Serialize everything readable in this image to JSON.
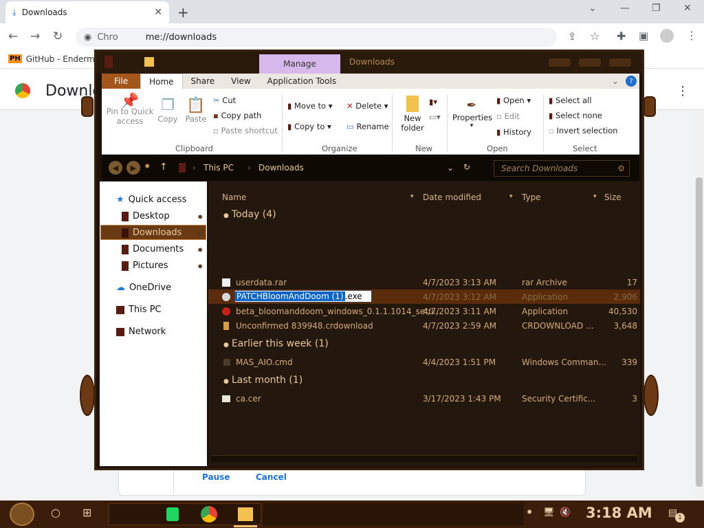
{
  "browser": {
    "tab_title": "Downloads",
    "tab_close": "✕",
    "new_tab": "+",
    "url_prefix": "Chro",
    "url": "me://downloads",
    "bookmark_badge": "PH",
    "bookmark_label": "GitHub - Enderma",
    "page_title": "Downlo",
    "pause": "Pause",
    "cancel": "Cancel"
  },
  "explorer": {
    "manage_tab": "Manage",
    "window_title": "Downloads",
    "tabs": [
      "File",
      "Home",
      "Share",
      "View",
      "Application Tools"
    ],
    "ribbon": {
      "pin": "Pin to Quick access",
      "copy": "Copy",
      "paste": "Paste",
      "cut": "Cut",
      "copy_path": "Copy path",
      "paste_shortcut": "Paste shortcut",
      "move_to": "Move to ▾",
      "copy_to": "Copy to ▾",
      "delete": "Delete ▾",
      "rename": "Rename",
      "new_folder": "New folder",
      "properties": "Properties",
      "open": "Open ▾",
      "edit": "Edit",
      "history": "History",
      "select_all": "Select all",
      "select_none": "Select none",
      "invert_selection": "Invert selection",
      "groups": [
        "Clipboard",
        "Organize",
        "New",
        "Open",
        "Select"
      ]
    },
    "address": {
      "this_pc": "This PC",
      "downloads": "Downloads",
      "search_placeholder": "Search Downloads"
    },
    "nav": [
      "Quick access",
      "Desktop",
      "Downloads",
      "Documents",
      "Pictures",
      "OneDrive",
      "This PC",
      "Network"
    ],
    "columns": [
      "Name",
      "Date modified",
      "Type",
      "Size"
    ],
    "groups": {
      "today": "Today (4)",
      "week": "Earlier this week (1)",
      "month": "Last month (1)"
    },
    "files": [
      {
        "name": "userdata.rar",
        "date": "4/7/2023 3:13 AM",
        "type": "rar Archive",
        "size": "17"
      },
      {
        "name": "PATCHBloomAndDoom (1)",
        "ext": ".exe",
        "date": "4/7/2023 3:12 AM",
        "type": "Application",
        "size": "2,906"
      },
      {
        "name": "beta_bloomanddoom_windows_0.1.1.1014_setu...",
        "date": "4/7/2023 3:11 AM",
        "type": "Application",
        "size": "40,530"
      },
      {
        "name": "Unconfirmed 839948.crdownload",
        "date": "4/7/2023 2:59 AM",
        "type": "CRDOWNLOAD ...",
        "size": "3,648"
      },
      {
        "name": "MAS_AIO.cmd",
        "date": "4/4/2023 1:51 PM",
        "type": "Windows Comman...",
        "size": "339"
      },
      {
        "name": "ca.cer",
        "date": "3/17/2023 1:43 PM",
        "type": "Security Certific...",
        "size": "3"
      }
    ]
  },
  "taskbar": {
    "clock": "3:18 AM",
    "notif_count": "1"
  }
}
